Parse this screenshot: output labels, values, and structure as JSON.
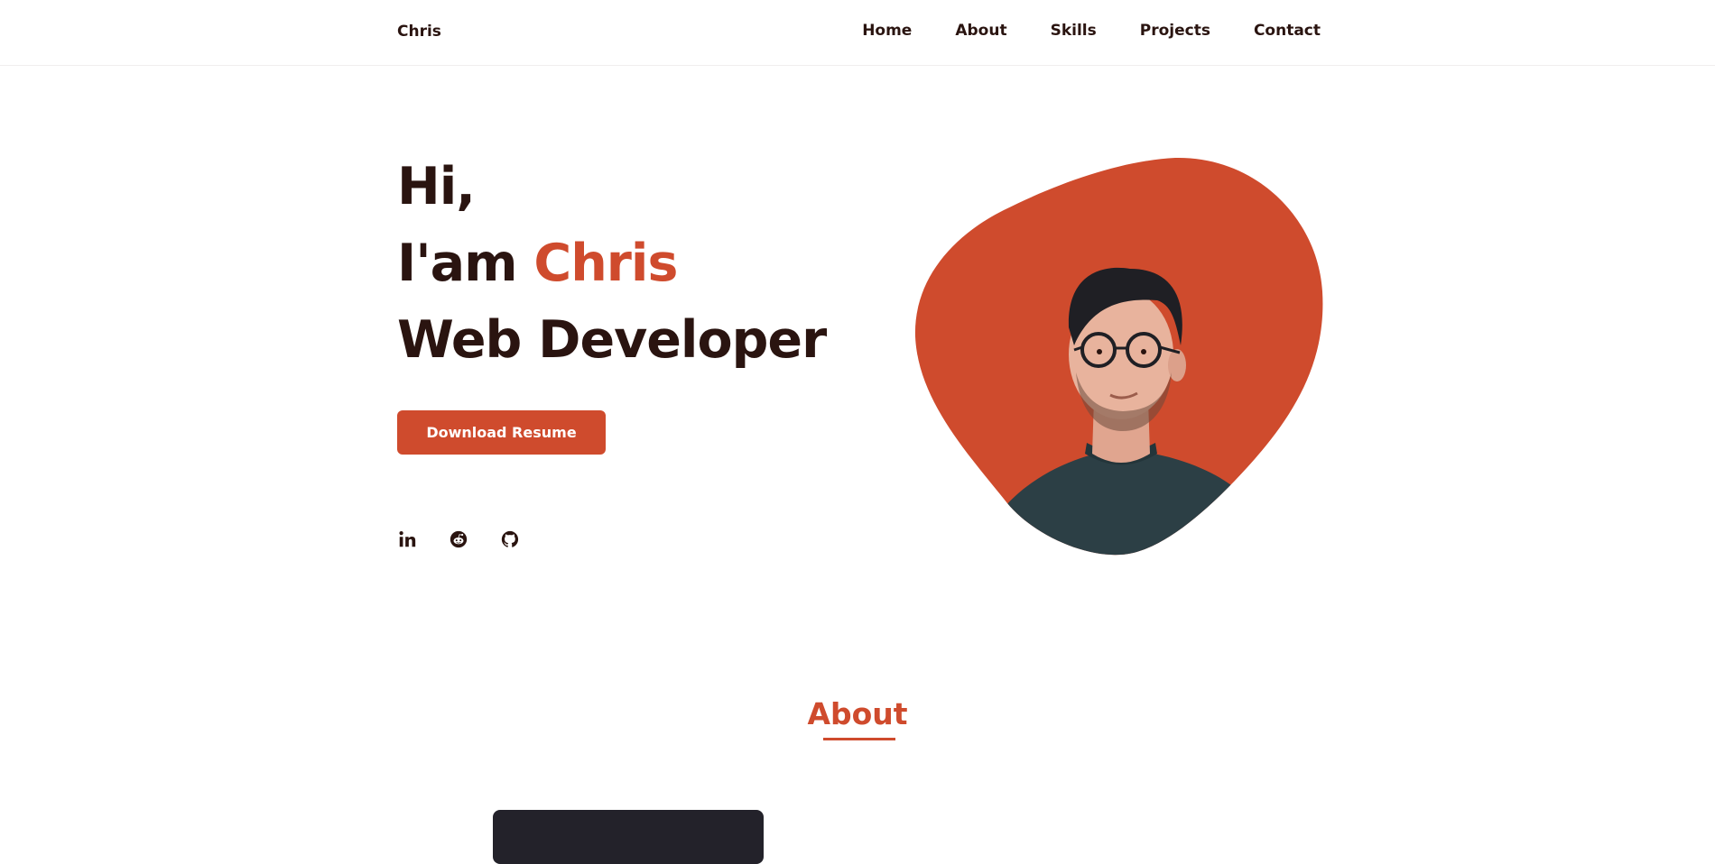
{
  "header": {
    "logo": "Chris",
    "nav": [
      "Home",
      "About",
      "Skills",
      "Projects",
      "Contact"
    ]
  },
  "hero": {
    "line1": "Hi,",
    "line2_prefix": "I'am",
    "line2_name": "Chris",
    "line3": "Web Developer",
    "button_label": "Download Resume",
    "socials": [
      {
        "icon": "linkedin-icon"
      },
      {
        "icon": "reddit-icon"
      },
      {
        "icon": "github-icon"
      }
    ],
    "blob_color": "#cf4b2d"
  },
  "about": {
    "title": "About"
  },
  "colors": {
    "accent": "#cf4b2d",
    "text_dark": "#2a1410",
    "card_dark": "#23222a"
  }
}
